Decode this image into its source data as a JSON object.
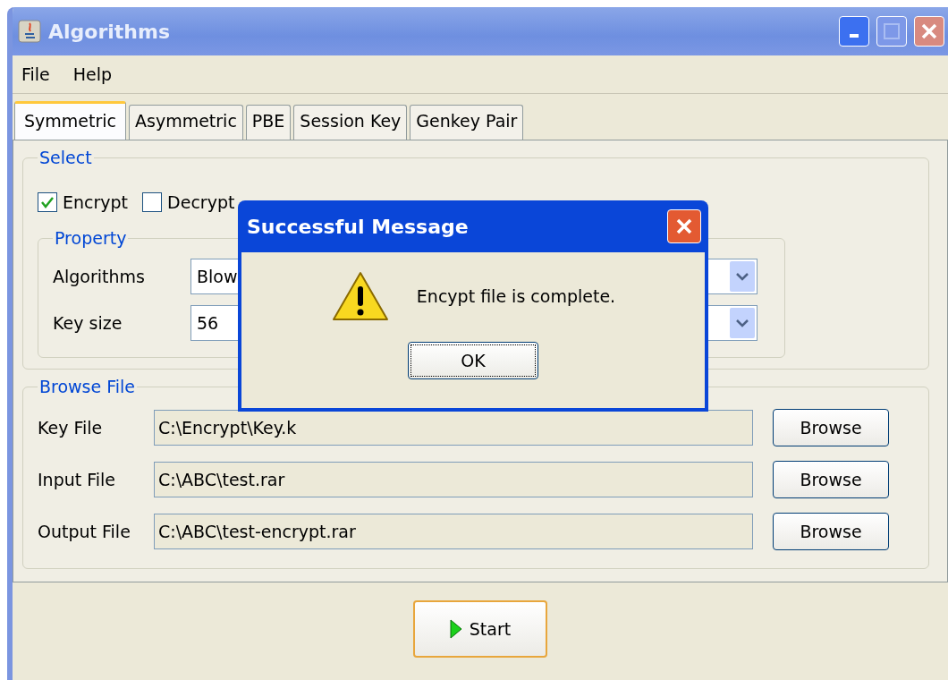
{
  "window": {
    "title": "Algorithms"
  },
  "menu": [
    {
      "label": "File"
    },
    {
      "label": "Help"
    }
  ],
  "tabs": [
    {
      "label": "Symmetric",
      "selected": true
    },
    {
      "label": "Asymmetric",
      "selected": false
    },
    {
      "label": "PBE",
      "selected": false
    },
    {
      "label": "Session Key",
      "selected": false
    },
    {
      "label": "Genkey Pair",
      "selected": false
    }
  ],
  "select": {
    "title": "Select",
    "options": [
      {
        "label": "Encrypt",
        "checked": true
      },
      {
        "label": "Decrypt",
        "checked": false
      }
    ]
  },
  "property": {
    "title": "Property",
    "rows": [
      {
        "label": "Algorithms",
        "value": "Blow"
      },
      {
        "label": "Key size",
        "value": "56"
      }
    ]
  },
  "browse": {
    "title": "Browse File",
    "rows": [
      {
        "label": "Key File",
        "value": "C:\\Encrypt\\Key.k",
        "button": "Browse"
      },
      {
        "label": "Input File",
        "value": "C:\\ABC\\test.rar",
        "button": "Browse"
      },
      {
        "label": "Output File",
        "value": "C:\\ABC\\test-encrypt.rar",
        "button": "Browse"
      }
    ]
  },
  "start_button": "Start",
  "dialog": {
    "title": "Successful Message",
    "message": "Encypt file is complete.",
    "button": "OK"
  }
}
